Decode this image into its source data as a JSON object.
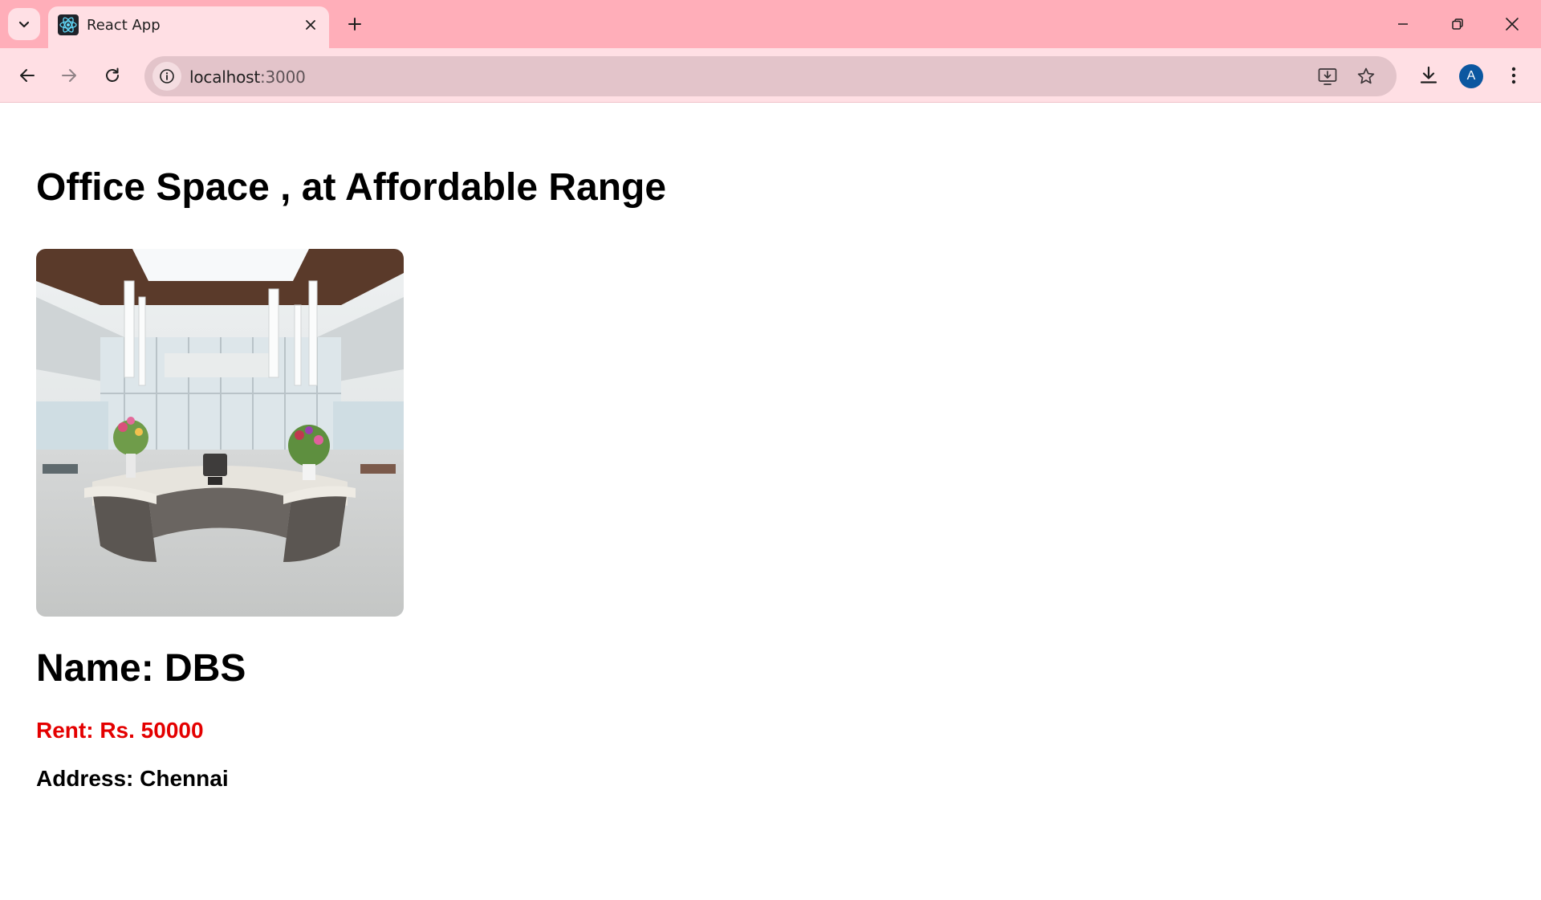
{
  "browser": {
    "tab_title": "React App",
    "url_host": "localhost",
    "url_port": ":3000",
    "profile_initial": "A"
  },
  "page": {
    "heading": "Office Space , at Affordable Range",
    "name": "Name: DBS",
    "rent": "Rent: Rs. 50000",
    "address": "Address: Chennai"
  },
  "colors": {
    "rent_text": "#e40000",
    "tabbar_bg": "#ffaeb9",
    "toolbar_bg": "#ffdfe4"
  },
  "icons": {
    "favicon": "react-logo-icon",
    "photo": "office-lobby-reception-desk"
  }
}
